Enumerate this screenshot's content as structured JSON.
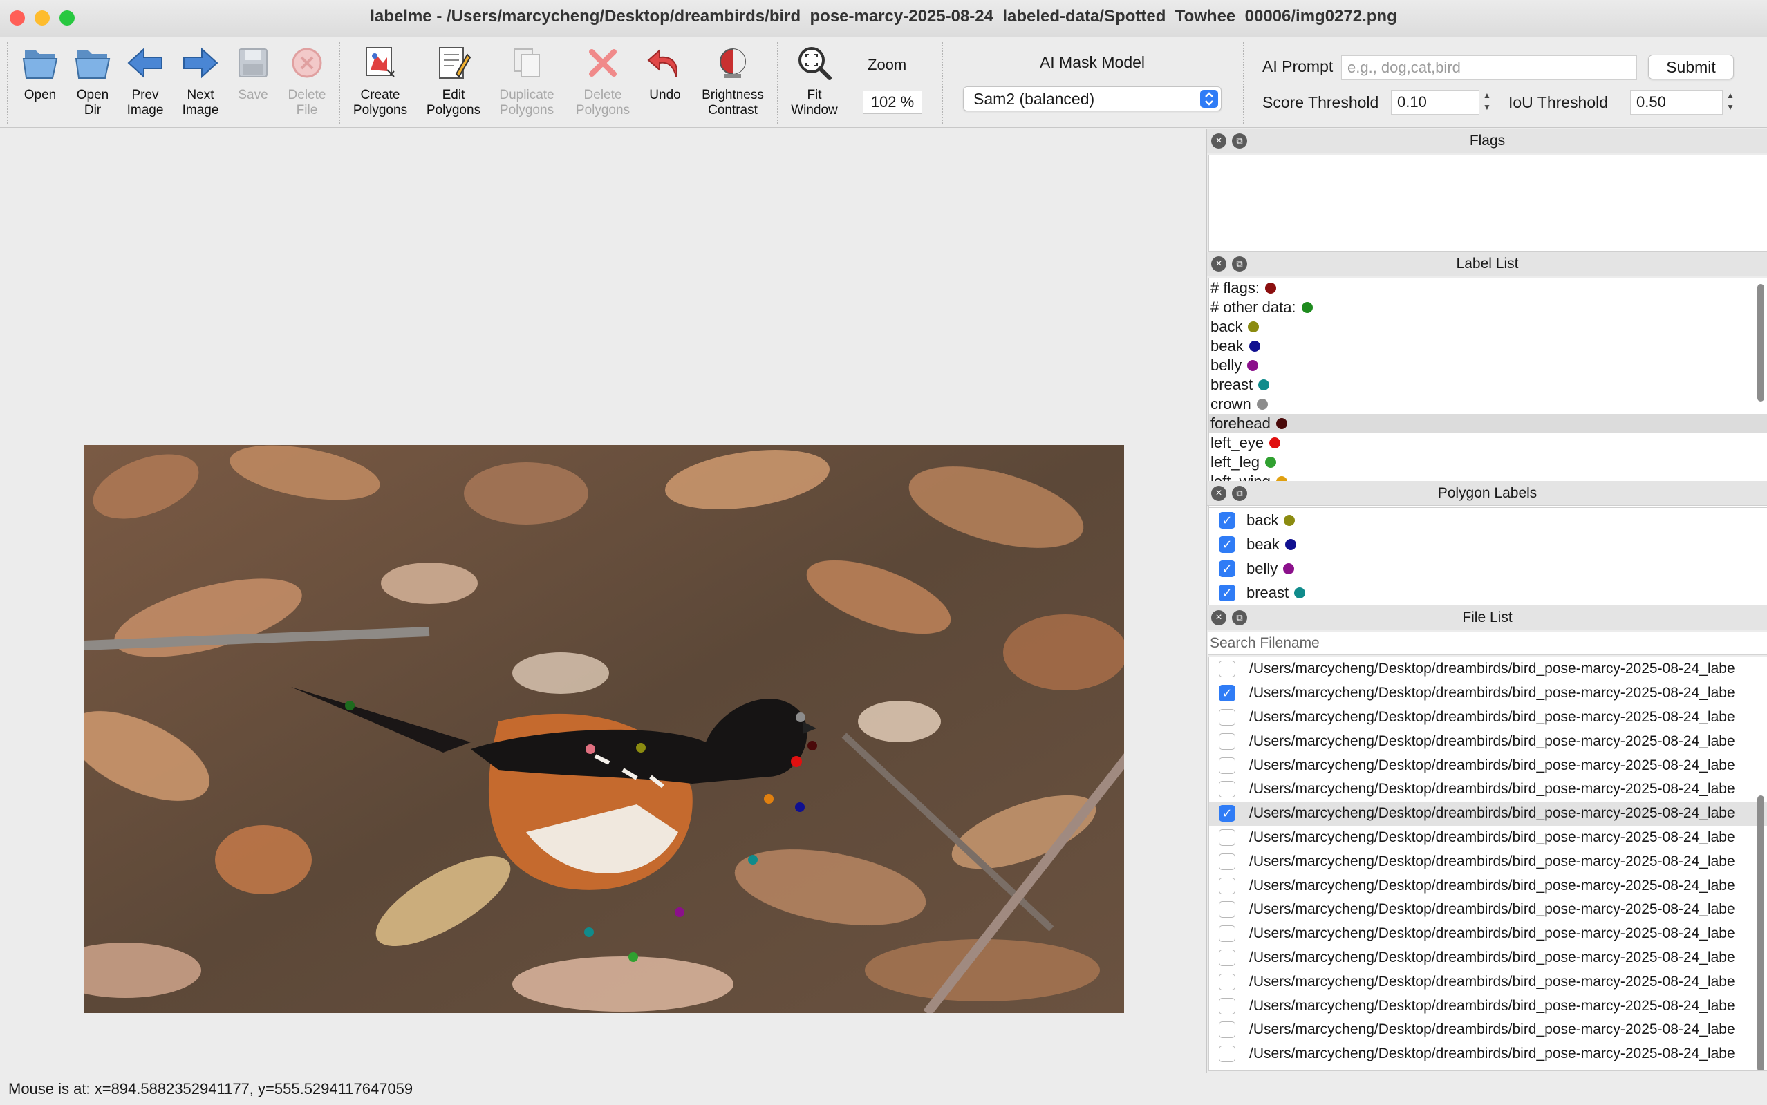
{
  "window": {
    "title": "labelme - /Users/marcycheng/Desktop/dreambirds/bird_pose-marcy-2025-08-24_labeled-data/Spotted_Towhee_00006/img0272.png",
    "traffic_colors": [
      "#ff5f57",
      "#febc2e",
      "#28c840"
    ]
  },
  "toolbar": {
    "open": "Open",
    "open_dir": "Open\nDir",
    "prev_image": "Prev\nImage",
    "next_image": "Next\nImage",
    "save": "Save",
    "delete_file": "Delete\nFile",
    "create_polygons": "Create\nPolygons",
    "edit_polygons": "Edit\nPolygons",
    "duplicate_polygons": "Duplicate\nPolygons",
    "delete_polygons": "Delete\nPolygons",
    "undo": "Undo",
    "brightness_contrast": "Brightness\nContrast",
    "fit_window": "Fit\nWindow",
    "zoom_label": "Zoom",
    "zoom_value": "102 %",
    "ai_mask_model_label": "AI Mask Model",
    "ai_mask_model_value": "Sam2 (balanced)",
    "ai_prompt_label": "AI Prompt",
    "ai_prompt_placeholder": "e.g., dog,cat,bird",
    "ai_prompt_value": "",
    "submit": "Submit",
    "score_threshold_label": "Score Threshold",
    "score_threshold_value": "0.10",
    "iou_threshold_label": "IoU Threshold",
    "iou_threshold_value": "0.50"
  },
  "flags_panel": {
    "title": "Flags"
  },
  "label_list": {
    "title": "Label List",
    "items": [
      {
        "label": "# flags:",
        "color": "#8b0f0f"
      },
      {
        "label": "# other data:",
        "color": "#1e8b1e"
      },
      {
        "label": "back",
        "color": "#8b8b10"
      },
      {
        "label": "beak",
        "color": "#101090"
      },
      {
        "label": "belly",
        "color": "#8b108b"
      },
      {
        "label": "breast",
        "color": "#108b8b"
      },
      {
        "label": "crown",
        "color": "#8c8c8c"
      },
      {
        "label": "forehead",
        "color": "#4a0a0a",
        "selected": true
      },
      {
        "label": "left_eye",
        "color": "#e01010"
      },
      {
        "label": "left_leg",
        "color": "#30a030"
      },
      {
        "label": "left_wing",
        "color": "#e0a010"
      }
    ]
  },
  "polygon_labels": {
    "title": "Polygon Labels",
    "items": [
      {
        "label": "back",
        "color": "#8b8b10"
      },
      {
        "label": "beak",
        "color": "#101090"
      },
      {
        "label": "belly",
        "color": "#8b108b"
      },
      {
        "label": "breast",
        "color": "#108b8b"
      }
    ]
  },
  "file_list": {
    "title": "File List",
    "search_placeholder": "Search Filename",
    "items": [
      {
        "path": "/Users/marcycheng/Desktop/dreambirds/bird_pose-marcy-2025-08-24_labe",
        "checked": false
      },
      {
        "path": "/Users/marcycheng/Desktop/dreambirds/bird_pose-marcy-2025-08-24_labe",
        "checked": true
      },
      {
        "path": "/Users/marcycheng/Desktop/dreambirds/bird_pose-marcy-2025-08-24_labe",
        "checked": false
      },
      {
        "path": "/Users/marcycheng/Desktop/dreambirds/bird_pose-marcy-2025-08-24_labe",
        "checked": false
      },
      {
        "path": "/Users/marcycheng/Desktop/dreambirds/bird_pose-marcy-2025-08-24_labe",
        "checked": false
      },
      {
        "path": "/Users/marcycheng/Desktop/dreambirds/bird_pose-marcy-2025-08-24_labe",
        "checked": false
      },
      {
        "path": "/Users/marcycheng/Desktop/dreambirds/bird_pose-marcy-2025-08-24_labe",
        "checked": true,
        "selected": true
      },
      {
        "path": "/Users/marcycheng/Desktop/dreambirds/bird_pose-marcy-2025-08-24_labe",
        "checked": false
      },
      {
        "path": "/Users/marcycheng/Desktop/dreambirds/bird_pose-marcy-2025-08-24_labe",
        "checked": false
      },
      {
        "path": "/Users/marcycheng/Desktop/dreambirds/bird_pose-marcy-2025-08-24_labe",
        "checked": false
      },
      {
        "path": "/Users/marcycheng/Desktop/dreambirds/bird_pose-marcy-2025-08-24_labe",
        "checked": false
      },
      {
        "path": "/Users/marcycheng/Desktop/dreambirds/bird_pose-marcy-2025-08-24_labe",
        "checked": false
      },
      {
        "path": "/Users/marcycheng/Desktop/dreambirds/bird_pose-marcy-2025-08-24_labe",
        "checked": false
      },
      {
        "path": "/Users/marcycheng/Desktop/dreambirds/bird_pose-marcy-2025-08-24_labe",
        "checked": false
      },
      {
        "path": "/Users/marcycheng/Desktop/dreambirds/bird_pose-marcy-2025-08-24_labe",
        "checked": false
      },
      {
        "path": "/Users/marcycheng/Desktop/dreambirds/bird_pose-marcy-2025-08-24_labe",
        "checked": false
      },
      {
        "path": "/Users/marcycheng/Desktop/dreambirds/bird_pose-marcy-2025-08-24_labe",
        "checked": false
      }
    ]
  },
  "keypoint_colors": [
    "#108b8b",
    "#e07080",
    "#8b8b10",
    "#1e6b1e",
    "#8c8c8c",
    "#e01010",
    "#4a0a0a",
    "#101090",
    "#e08010",
    "#108b8b",
    "#8b108b",
    "#108b8b",
    "#30a030"
  ],
  "status": {
    "text": "Mouse is at: x=894.5882352941177, y=555.5294117647059"
  }
}
